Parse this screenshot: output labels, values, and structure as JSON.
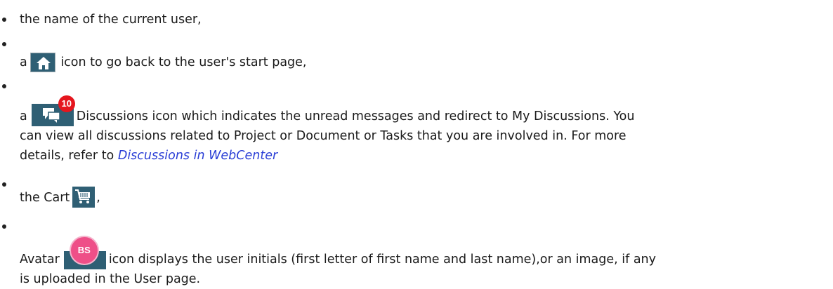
{
  "items": [
    {
      "text": "the name of the current user,"
    },
    {
      "prefix": "a",
      "icon": "home-icon",
      "text": "icon to go back to the user's start page,"
    },
    {
      "prefix": "a",
      "icon": "discussions-icon",
      "badge": "10",
      "line1": "Discussions icon which indicates the unread messages and redirect to My Discussions. You",
      "line2": "can view all discussions related to Project or Document or Tasks that you are involved in. For more",
      "line3_prefix": "details, refer to",
      "link": "Discussions in WebCenter"
    },
    {
      "prefix": "the Cart",
      "icon": "cart-icon",
      "suffix": ","
    },
    {
      "prefix": "Avatar",
      "icon": "avatar-icon",
      "initials": "BS",
      "line1": "icon displays the user initials (first letter of first name and last name),or an image, if any",
      "line2": "is uploaded in the User page."
    }
  ],
  "colors": {
    "icon_bg": "#2f5f74",
    "badge": "#e5161e",
    "avatar": "#ee4f88",
    "link": "#2a3ed6"
  }
}
